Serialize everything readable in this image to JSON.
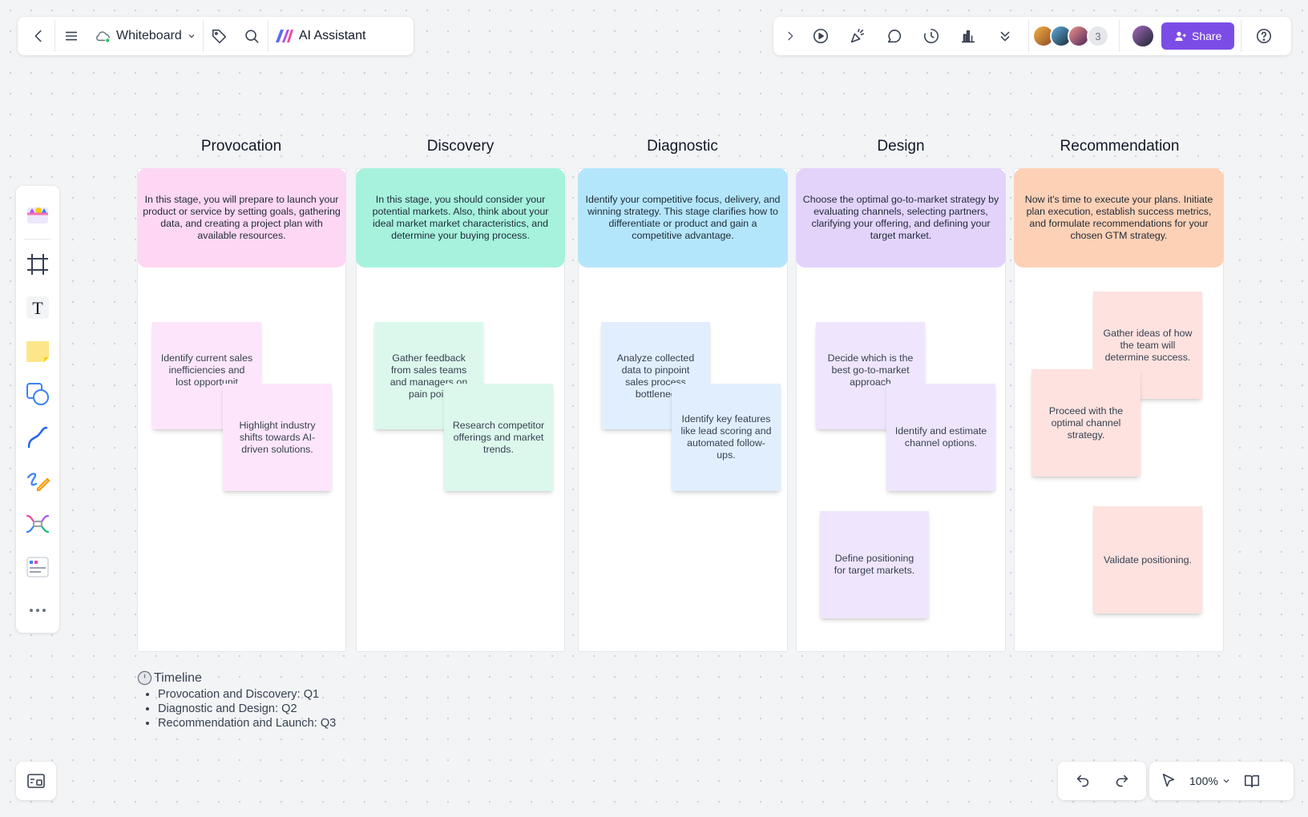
{
  "toolbar_left": {
    "back_icon": "chevron-left-icon",
    "menu_icon": "hamburger-icon",
    "board_name": "Whiteboard",
    "tag_icon": "tag-icon",
    "search_icon": "search-icon",
    "ai_label": "AI Assistant"
  },
  "toolbar_right": {
    "collapse_icon": "chevron-right-icon",
    "tools": [
      "play-icon",
      "celebrate-icon",
      "comment-icon",
      "timer-icon",
      "vote-icon",
      "more-down-icon"
    ],
    "avatar_count": "3",
    "share_label": "Share",
    "help_icon": "help-icon"
  },
  "columns": [
    {
      "title": "Provocation",
      "description": "In this stage, you will prepare to launch your product or service by setting goals, gathering data, and creating a project plan with available resources.",
      "color": "#fdd7f4"
    },
    {
      "title": "Discovery",
      "description": "In this stage, you should consider your potential markets. Also, think about your ideal market market characteristics, and determine your buying process.",
      "color": "#a6f2dd"
    },
    {
      "title": "Diagnostic",
      "description": "Identify your competitive focus, delivery, and winning strategy. This stage clarifies how to differentiate or product and gain a competitive advantage.",
      "color": "#b4e6fb"
    },
    {
      "title": "Design",
      "description": "Choose the optimal go-to-market strategy by evaluating channels, selecting partners, clarifying your offering, and defining your target market.",
      "color": "#e3d3fb"
    },
    {
      "title": "Recommendation",
      "description": "Now it's time to execute your plans. Initiate plan execution, establish success metrics, and formulate recommendations for your chosen GTM strategy.",
      "color": "#fdd1b6"
    }
  ],
  "stickies": [
    {
      "text": "Identify current sales inefficiencies and lost opportunit",
      "color": "#fde6fb"
    },
    {
      "text": "Highlight industry shifts towards AI-driven solutions.",
      "color": "#fde6fb"
    },
    {
      "text": "Gather feedback from sales teams and managers on pain poin",
      "color": "#dcf8ec"
    },
    {
      "text": "Research competitor offerings and market trends.",
      "color": "#dcf8ec"
    },
    {
      "text": "Analyze collected data to pinpoint sales process bottlenec",
      "color": "#e1eefd"
    },
    {
      "text": "Identify key features like lead scoring and automated follow-ups.",
      "color": "#e1eefd"
    },
    {
      "text": "Decide which is the best go-to-market approach",
      "color": "#efe6fd"
    },
    {
      "text": "Identify and estimate channel options.",
      "color": "#efe6fd"
    },
    {
      "text": "Define positioning for target markets.",
      "color": "#efe6fd"
    },
    {
      "text": "Gather ideas of how the team will determine success.",
      "color": "#fde2df"
    },
    {
      "text": "Proceed with the optimal channel strategy.",
      "color": "#fde2df"
    },
    {
      "text": "Validate positioning.",
      "color": "#fde2df"
    }
  ],
  "timeline": {
    "title": "Timeline",
    "items": [
      "Provocation and Discovery: Q1",
      "Diagnostic and Design: Q2",
      "Recommendation and Launch: Q3"
    ]
  },
  "left_tools": [
    "template-icon",
    "frame-icon",
    "text-icon",
    "sticky-note-icon",
    "shape-icon",
    "connector-icon",
    "pen-icon",
    "mindmap-icon",
    "card-icon",
    "more-icon"
  ],
  "bottom": {
    "zoom_level": "100%",
    "undo_icon": "undo-icon",
    "redo_icon": "redo-icon",
    "select_icon": "pointer-icon",
    "guide_icon": "book-icon",
    "minimap_icon": "minimap-icon"
  },
  "colors": {
    "accent": "#7c4de6"
  }
}
